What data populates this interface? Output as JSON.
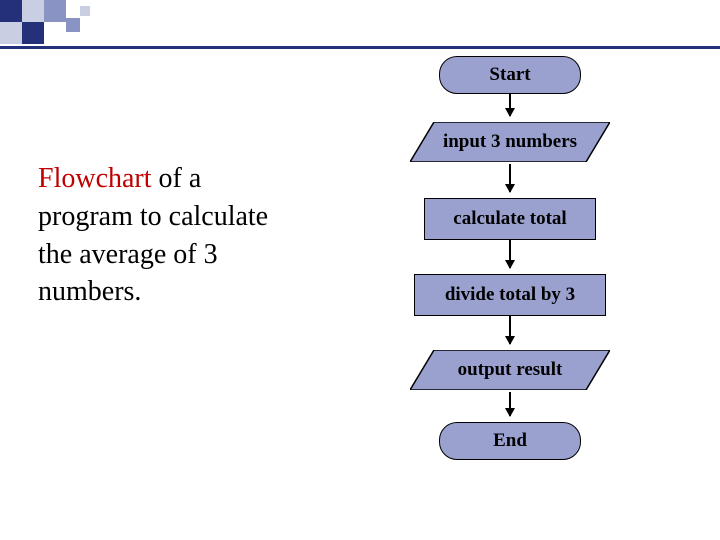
{
  "description": {
    "highlight_word": "Flowchart",
    "rest": " of a program to calculate the average of 3 numbers."
  },
  "flowchart": {
    "start": "Start",
    "input": "input 3 numbers",
    "calc_total": "calculate total",
    "divide": "divide total by 3",
    "output": "output result",
    "end": "End"
  }
}
